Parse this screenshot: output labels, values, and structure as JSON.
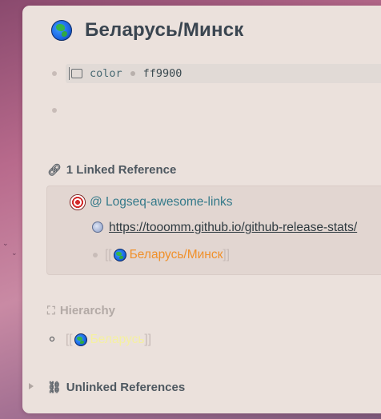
{
  "page": {
    "title": "Беларусь/Минск",
    "icon": "globe-icon"
  },
  "property": {
    "key": "color",
    "value": "ff9900"
  },
  "linked_refs": {
    "header": "1 Linked Reference",
    "source_page": "@ Logseq-awesome-links",
    "url": "https://tooomm.github.io/github-release-stats/",
    "ref_open": "[[",
    "ref_label": "Беларусь/Минск",
    "ref_close": "]]"
  },
  "hierarchy": {
    "header": "Hierarchy",
    "open": "[[",
    "item": "Беларусь",
    "close": "]]"
  },
  "unlinked_refs": {
    "header": "Unlinked References"
  },
  "colors": {
    "accent_orange": "#f0902a",
    "link_teal": "#357a8a",
    "hierarchy_yellow": "#f5f0a0"
  }
}
